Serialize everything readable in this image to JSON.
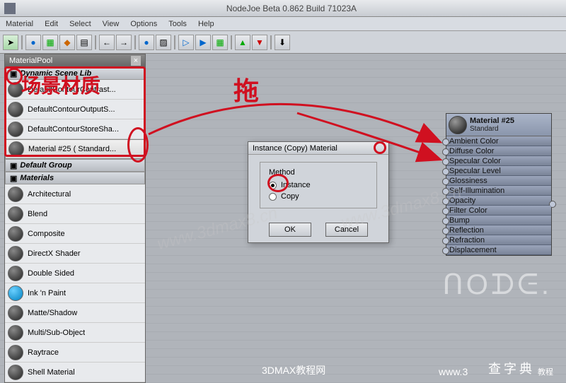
{
  "window": {
    "title": "NodeJoe Beta 0.862 Build 71023A"
  },
  "menu": {
    "items": [
      "Material",
      "Edit",
      "Select",
      "View",
      "Options",
      "Tools",
      "Help"
    ]
  },
  "panel": {
    "title": "MaterialPool",
    "sections": {
      "dynamic": {
        "label": "Dynamic Scene Lib",
        "items": [
          {
            "label": "DefaultContourContrast..."
          },
          {
            "label": "DefaultContourOutputS..."
          },
          {
            "label": "DefaultContourStoreSha..."
          },
          {
            "label": "Material #25  ( Standard...",
            "selected": true
          }
        ]
      },
      "default_group": {
        "label": "Default Group"
      },
      "materials": {
        "label": "Materials",
        "items": [
          {
            "label": "Architectural"
          },
          {
            "label": "Blend"
          },
          {
            "label": "Composite"
          },
          {
            "label": "DirectX Shader"
          },
          {
            "label": "Double Sided"
          },
          {
            "label": "Ink 'n Paint",
            "blue": true
          },
          {
            "label": "Matte/Shadow"
          },
          {
            "label": "Multi/Sub-Object"
          },
          {
            "label": "Raytrace"
          },
          {
            "label": "Shell Material"
          }
        ]
      }
    }
  },
  "dialog": {
    "title": "Instance (Copy) Material",
    "method_label": "Method",
    "options": {
      "instance": "Instance",
      "copy": "Copy"
    },
    "buttons": {
      "ok": "OK",
      "cancel": "Cancel"
    }
  },
  "node": {
    "title": "Material #25",
    "subtitle": "Standard",
    "slots": [
      "Ambient Color",
      "Diffuse Color",
      "Specular Color",
      "Specular Level",
      "Glossiness",
      "Self-Illumination",
      "Opacity",
      "Filter Color",
      "Bump",
      "Reflection",
      "Refraction",
      "Displacement"
    ]
  },
  "annotations": {
    "drag": "拖",
    "scene_materials": "场景材质"
  },
  "watermarks": {
    "url1": "www.3dmax8.cn",
    "url2": "www.3dmax8.cn",
    "footer": "3DMAX教程网",
    "footer2": "www.3",
    "zidian": "查字典",
    "jiaocheng": "教程"
  }
}
